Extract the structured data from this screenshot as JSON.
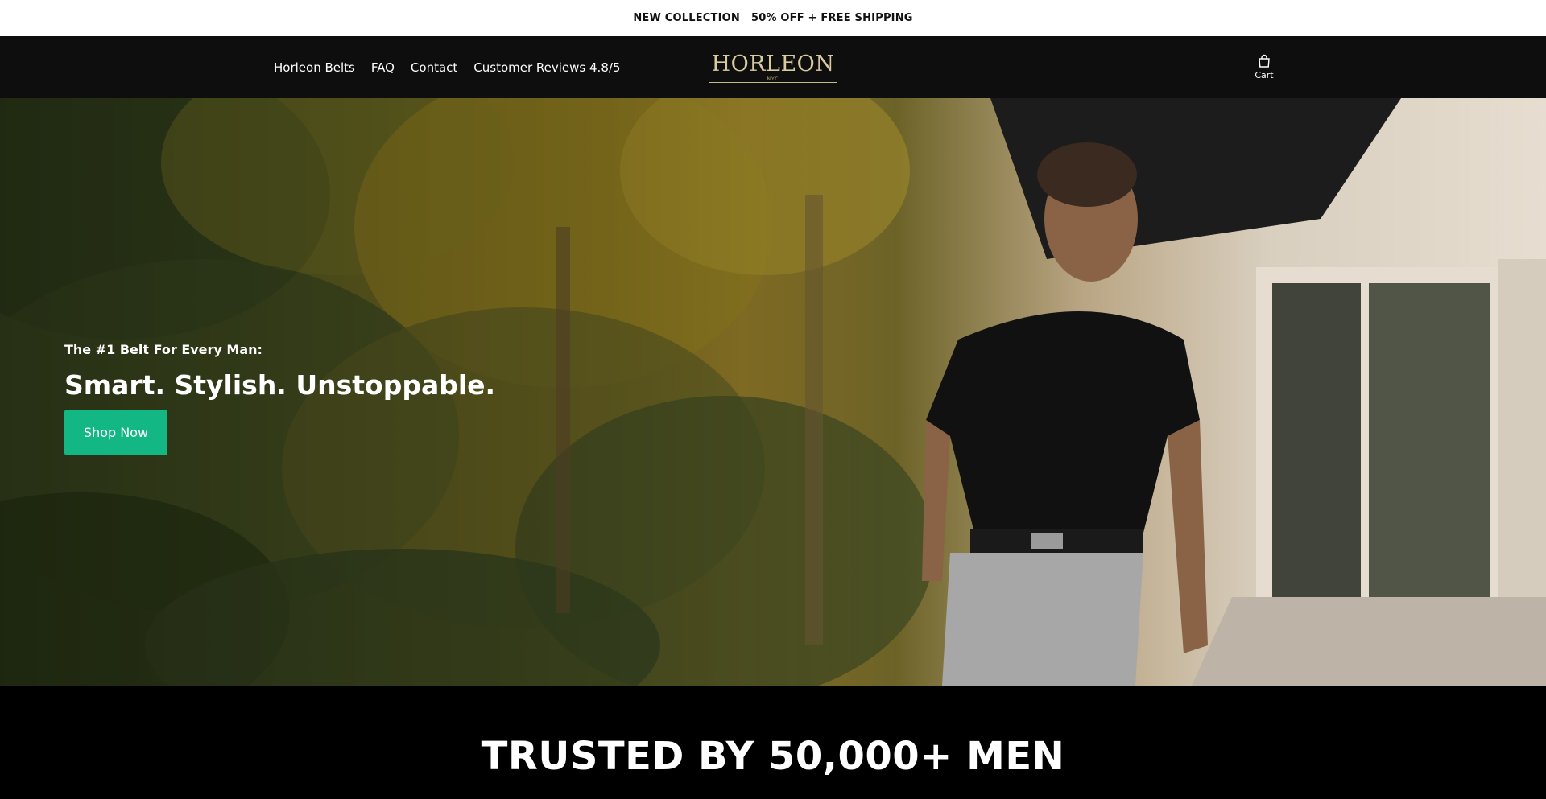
{
  "announcement": {
    "left": "NEW COLLECTION",
    "right": "50% OFF + FREE SHIPPING"
  },
  "nav": {
    "items": [
      {
        "label": "Horleon Belts"
      },
      {
        "label": "FAQ"
      },
      {
        "label": "Contact"
      },
      {
        "label": "Customer Reviews 4.8/5"
      }
    ]
  },
  "brand": {
    "logo_text": "HORLEON",
    "logo_subtext": "NYC"
  },
  "cart": {
    "label": "Cart",
    "icon": "shopping-bag-icon"
  },
  "hero": {
    "eyebrow": "The #1 Belt For Every Man:",
    "title": "Smart. Stylish. Unstoppable.",
    "cta_label": "Shop Now"
  },
  "trust": {
    "heading": "TRUSTED BY 50,000+ MEN"
  },
  "colors": {
    "header_bg": "#0e0e0e",
    "cta": "#13b784",
    "logo_gold": "#d9cba0",
    "announcement_bg": "#ffffff",
    "trust_bg": "#000000"
  }
}
